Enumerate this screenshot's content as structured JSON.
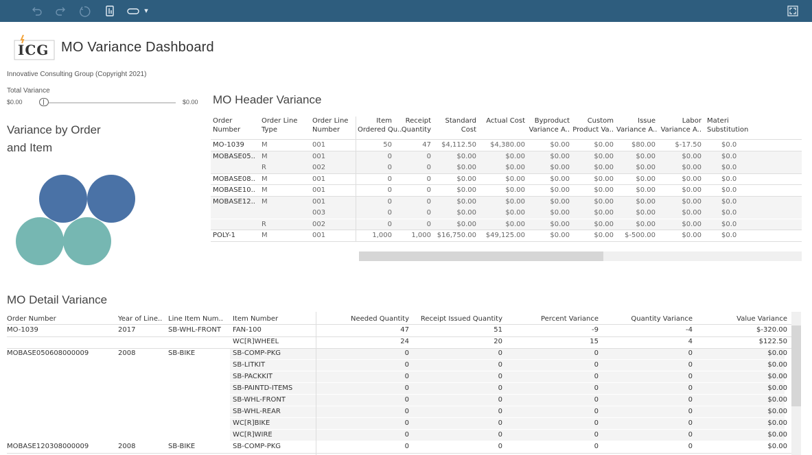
{
  "toolbar": {
    "icons": [
      "undo-icon",
      "redo-icon",
      "revert-icon",
      "pause-icon",
      "share-icon",
      "fullscreen-icon"
    ],
    "menu_caret": "▾"
  },
  "header": {
    "logo_text": "ICG",
    "title": "MO Variance Dashboard",
    "subtitle": "Innovative Consulting Group (Copyright 2021)"
  },
  "filter": {
    "label": "Total Variance",
    "min_value": "$0.00",
    "max_value": "$0.00"
  },
  "variance_by_order": {
    "title_line1": "Variance by Order",
    "title_line2": "and Item",
    "colors": [
      "#4a72a6",
      "#76b7b2"
    ]
  },
  "mo_header": {
    "title": "MO Header Variance",
    "columns": [
      [
        "Order",
        "Number"
      ],
      [
        "Order Line",
        "Type"
      ],
      [
        "Order Line",
        "Number"
      ],
      [
        "Item",
        "Ordered Qu.."
      ],
      [
        "Receipt",
        "Quantity"
      ],
      [
        "Standard",
        "Cost"
      ],
      [
        "",
        "Actual Cost"
      ],
      [
        "Byproduct",
        "Variance A.."
      ],
      [
        "Custom",
        "Product Va.."
      ],
      [
        "Issue",
        "Variance A.."
      ],
      [
        "Labor",
        "Variance A.."
      ],
      [
        "Materi",
        "Substitution"
      ]
    ],
    "rows": [
      [
        "MO-1039",
        "M",
        "001",
        "50",
        "47",
        "$4,112.50",
        "$4,380.00",
        "$0.00",
        "$0.00",
        "$80.00",
        "$-17.50",
        "$0.0"
      ],
      [
        "MOBASE05..",
        "M",
        "001",
        "0",
        "0",
        "$0.00",
        "$0.00",
        "$0.00",
        "$0.00",
        "$0.00",
        "$0.00",
        "$0.0"
      ],
      [
        "",
        "R",
        "002",
        "0",
        "0",
        "$0.00",
        "$0.00",
        "$0.00",
        "$0.00",
        "$0.00",
        "$0.00",
        "$0.0"
      ],
      [
        "MOBASE08..",
        "M",
        "001",
        "0",
        "0",
        "$0.00",
        "$0.00",
        "$0.00",
        "$0.00",
        "$0.00",
        "$0.00",
        "$0.0"
      ],
      [
        "MOBASE10..",
        "M",
        "001",
        "0",
        "0",
        "$0.00",
        "$0.00",
        "$0.00",
        "$0.00",
        "$0.00",
        "$0.00",
        "$0.0"
      ],
      [
        "MOBASE12..",
        "M",
        "001",
        "0",
        "0",
        "$0.00",
        "$0.00",
        "$0.00",
        "$0.00",
        "$0.00",
        "$0.00",
        "$0.0"
      ],
      [
        "",
        "",
        "003",
        "0",
        "0",
        "$0.00",
        "$0.00",
        "$0.00",
        "$0.00",
        "$0.00",
        "$0.00",
        "$0.0"
      ],
      [
        "",
        "R",
        "002",
        "0",
        "0",
        "$0.00",
        "$0.00",
        "$0.00",
        "$0.00",
        "$0.00",
        "$0.00",
        "$0.0"
      ],
      [
        "POLY-1",
        "M",
        "001",
        "1,000",
        "1,000",
        "$16,750.00",
        "$49,125.00",
        "$0.00",
        "$0.00",
        "$-500.00",
        "$0.00",
        "$0.0"
      ]
    ]
  },
  "mo_detail": {
    "title": "MO Detail Variance",
    "columns": [
      "Order Number",
      "Year of Line..",
      "Line Item Num..",
      "Item Number",
      "Needed Quantity",
      "Receipt Issued Quantity",
      "Percent Variance",
      "Quantity Variance",
      "Value Variance"
    ],
    "rows": [
      [
        "MO-1039",
        "2017",
        "SB-WHL-FRONT",
        "FAN-100",
        "47",
        "51",
        "-9",
        "-4",
        "$-320.00"
      ],
      [
        "",
        "",
        "",
        "WC[R]WHEEL",
        "24",
        "20",
        "15",
        "4",
        "$122.50"
      ],
      [
        "MOBASE050608000009",
        "2008",
        "SB-BIKE",
        "SB-COMP-PKG",
        "0",
        "0",
        "0",
        "0",
        "$0.00"
      ],
      [
        "",
        "",
        "",
        "SB-LITKIT",
        "0",
        "0",
        "0",
        "0",
        "$0.00"
      ],
      [
        "",
        "",
        "",
        "SB-PACKKIT",
        "0",
        "0",
        "0",
        "0",
        "$0.00"
      ],
      [
        "",
        "",
        "",
        "SB-PAINTD-ITEMS",
        "0",
        "0",
        "0",
        "0",
        "$0.00"
      ],
      [
        "",
        "",
        "",
        "SB-WHL-FRONT",
        "0",
        "0",
        "0",
        "0",
        "$0.00"
      ],
      [
        "",
        "",
        "",
        "SB-WHL-REAR",
        "0",
        "0",
        "0",
        "0",
        "$0.00"
      ],
      [
        "",
        "",
        "",
        "WC[R]BIKE",
        "0",
        "0",
        "0",
        "0",
        "$0.00"
      ],
      [
        "",
        "",
        "",
        "WC[R]WIRE",
        "0",
        "0",
        "0",
        "0",
        "$0.00"
      ],
      [
        "MOBASE120308000009",
        "2008",
        "SB-BIKE",
        "SB-COMP-PKG",
        "0",
        "0",
        "0",
        "0",
        "$0.00"
      ]
    ]
  }
}
